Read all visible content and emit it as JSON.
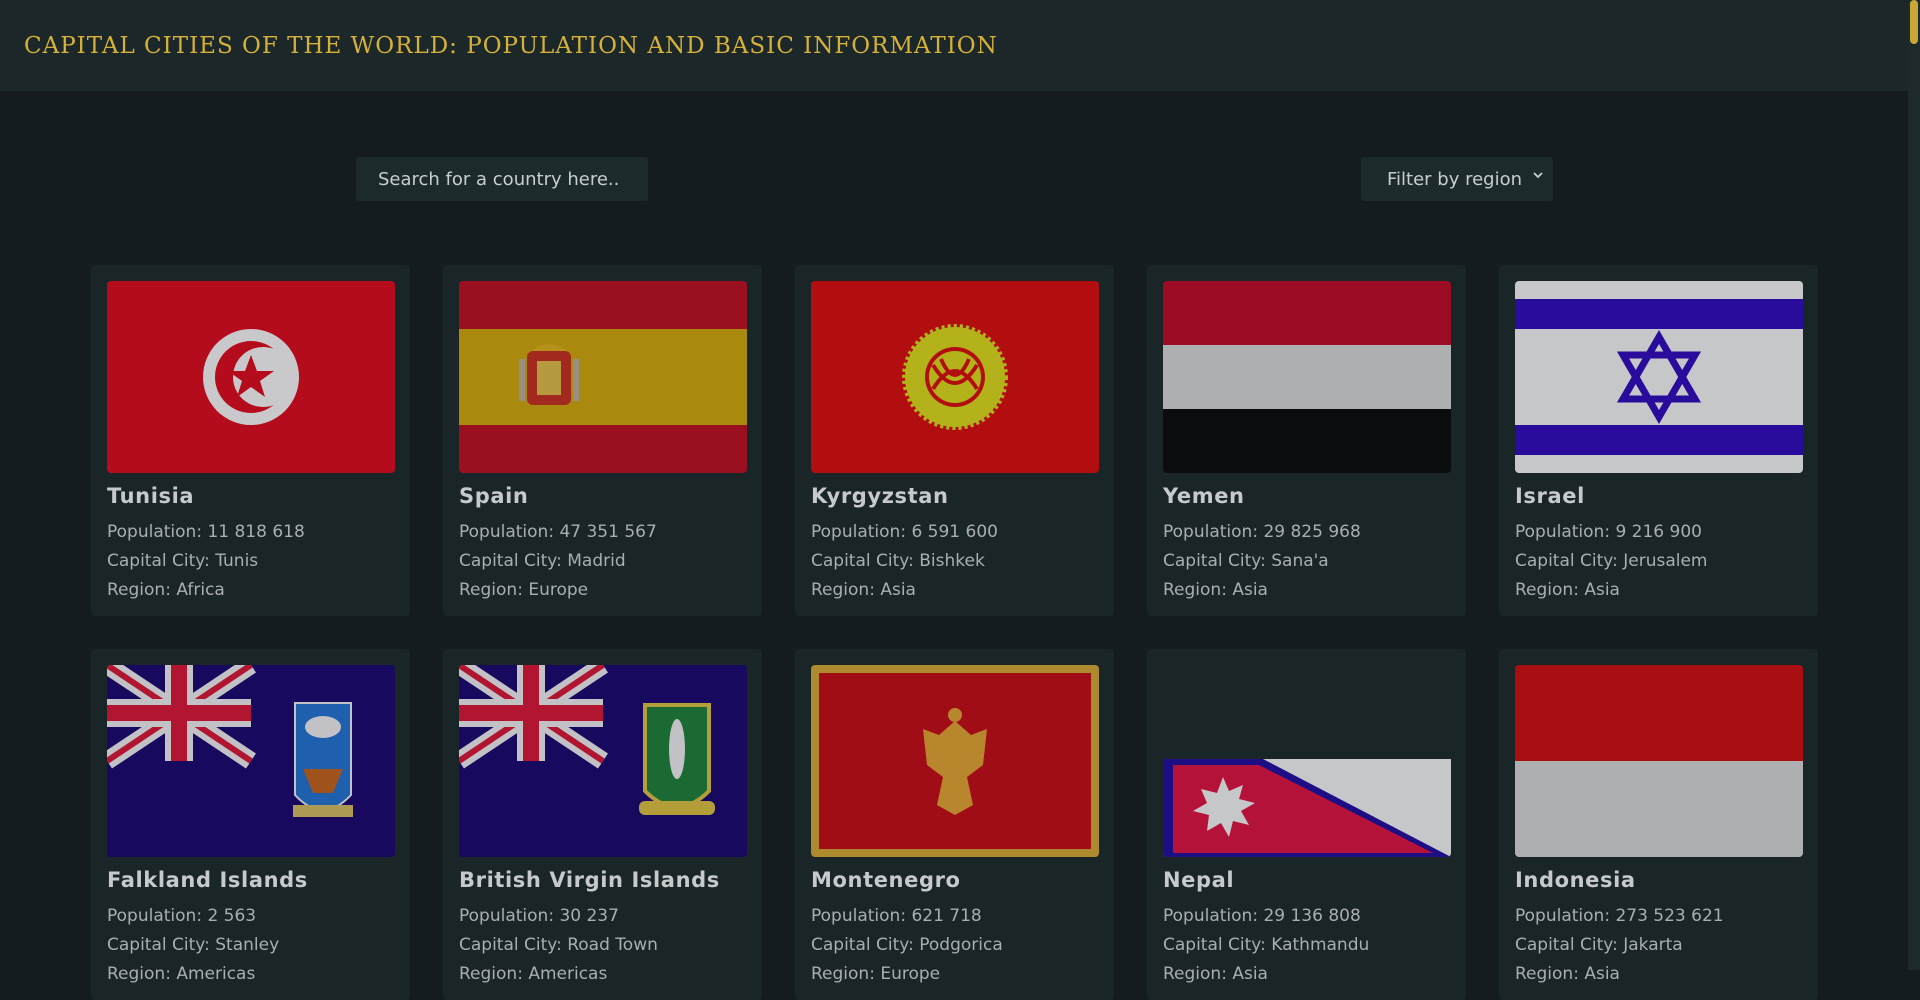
{
  "header": {
    "title": "CAPITAL CITIES OF THE WORLD: POPULATION AND BASIC INFORMATION"
  },
  "search": {
    "placeholder": "Search for a country here.."
  },
  "filter": {
    "label": "Filter by region"
  },
  "labels": {
    "population": "Population:",
    "capital": "Capital City:",
    "region": "Region:"
  },
  "countries": [
    {
      "name": "Tunisia",
      "population": "11 818 618",
      "capital": "Tunis",
      "region": "Africa"
    },
    {
      "name": "Spain",
      "population": "47 351 567",
      "capital": "Madrid",
      "region": "Europe"
    },
    {
      "name": "Kyrgyzstan",
      "population": "6 591 600",
      "capital": "Bishkek",
      "region": "Asia"
    },
    {
      "name": "Yemen",
      "population": "29 825 968",
      "capital": "Sana'a",
      "region": "Asia"
    },
    {
      "name": "Israel",
      "population": "9 216 900",
      "capital": "Jerusalem",
      "region": "Asia"
    },
    {
      "name": "Falkland Islands",
      "population": "2 563",
      "capital": "Stanley",
      "region": "Americas"
    },
    {
      "name": "British Virgin Islands",
      "population": "30 237",
      "capital": "Road Town",
      "region": "Americas"
    },
    {
      "name": "Montenegro",
      "population": "621 718",
      "capital": "Podgorica",
      "region": "Europe"
    },
    {
      "name": "Nepal",
      "population": "29 136 808",
      "capital": "Kathmandu",
      "region": "Asia"
    },
    {
      "name": "Indonesia",
      "population": "273 523 621",
      "capital": "Jakarta",
      "region": "Asia"
    }
  ],
  "colors": {
    "accent": "#d6b13a",
    "background": "#141c1f",
    "card": "#1a2527"
  }
}
